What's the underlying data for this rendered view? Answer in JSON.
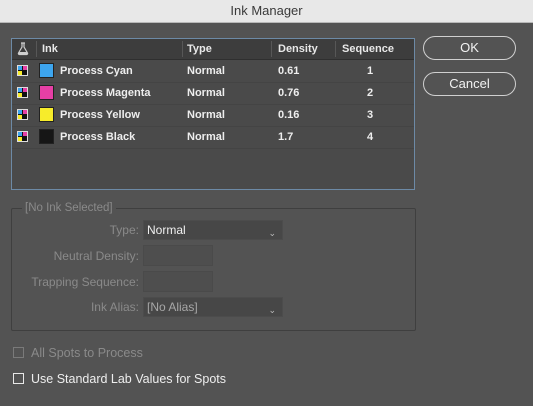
{
  "window": {
    "title": "Ink Manager"
  },
  "table": {
    "columns": [
      "Ink",
      "Type",
      "Density",
      "Sequence"
    ],
    "rows": [
      {
        "name": "Process Cyan",
        "type": "Normal",
        "density": "0.61",
        "sequence": "1",
        "color": "#3da5ee"
      },
      {
        "name": "Process Magenta",
        "type": "Normal",
        "density": "0.76",
        "sequence": "2",
        "color": "#e63fa5"
      },
      {
        "name": "Process Yellow",
        "type": "Normal",
        "density": "0.16",
        "sequence": "3",
        "color": "#f7ec2a"
      },
      {
        "name": "Process Black",
        "type": "Normal",
        "density": "1.7",
        "sequence": "4",
        "color": "#161616"
      }
    ]
  },
  "buttons": {
    "ok": "OK",
    "cancel": "Cancel"
  },
  "details": {
    "group_title": "[No Ink Selected]",
    "type_label": "Type:",
    "type_value": "Normal",
    "neutral_density_label": "Neutral Density:",
    "neutral_density_value": "",
    "trapping_sequence_label": "Trapping Sequence:",
    "trapping_sequence_value": "",
    "ink_alias_label": "Ink Alias:",
    "ink_alias_value": "[No Alias]"
  },
  "options": {
    "all_spots_label": "All Spots to Process",
    "all_spots_checked": false,
    "lab_values_label": "Use Standard Lab Values for Spots",
    "lab_values_checked": false
  },
  "icons": {
    "header": "ink-flask-icon",
    "row": "process-ink-icon",
    "dropdown": "chevron-down-icon"
  }
}
